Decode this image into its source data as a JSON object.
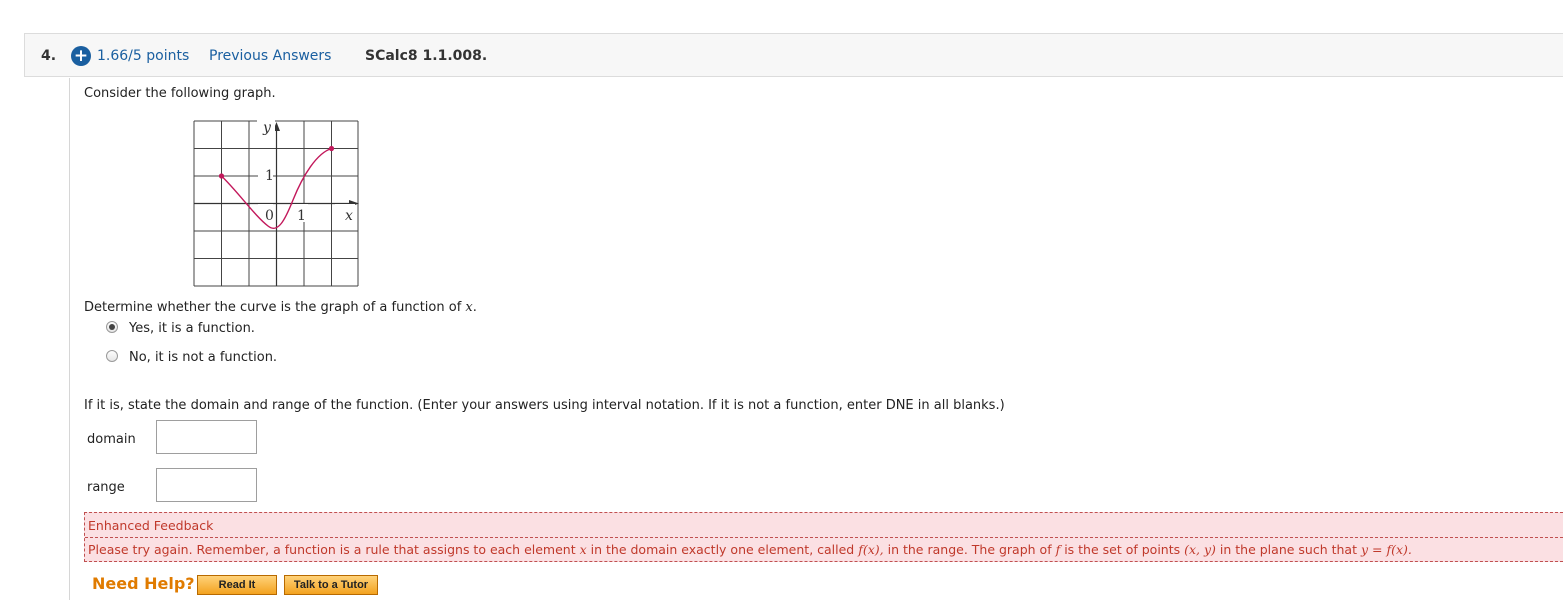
{
  "question": {
    "number": "4.",
    "points": "1.66/5 points",
    "previous_answers": "Previous Answers",
    "reference": "SCalc8 1.1.008."
  },
  "prompt": "Consider the following graph.",
  "graph": {
    "y_label": "y",
    "x_label": "x",
    "tick_y": "1",
    "tick_x": "1",
    "origin": "0",
    "curve_color": "#c2185b"
  },
  "part1": {
    "question_before": "Determine whether the curve is the graph of a function of ",
    "question_var": "x",
    "question_after": ".",
    "options": [
      {
        "label": "Yes, it is a function.",
        "selected": true
      },
      {
        "label": "No, it is not a function.",
        "selected": false
      }
    ]
  },
  "part2": {
    "instruction": "If it is, state the domain and range of the function. (Enter your answers using interval notation. If it is not a function, enter DNE in all blanks.)",
    "fields": [
      {
        "label": "domain",
        "value": ""
      },
      {
        "label": "range",
        "value": ""
      }
    ]
  },
  "feedback": {
    "title": "Enhanced Feedback",
    "t1": "Please try again. Remember, a function is a rule that assigns to each element ",
    "t2": "x",
    "t3": " in the domain exactly one element, called ",
    "t4": "f(x),",
    "t5": " in the range. The graph of ",
    "t6": "f",
    "t7": " is the set of points ",
    "t8": "(x, y)",
    "t9": " in the plane such that ",
    "t10": "y = f(x).",
    "color": "#c0392b"
  },
  "help": {
    "title": "Need Help?",
    "read_it": "Read It",
    "talk_to_tutor": "Talk to a Tutor"
  }
}
